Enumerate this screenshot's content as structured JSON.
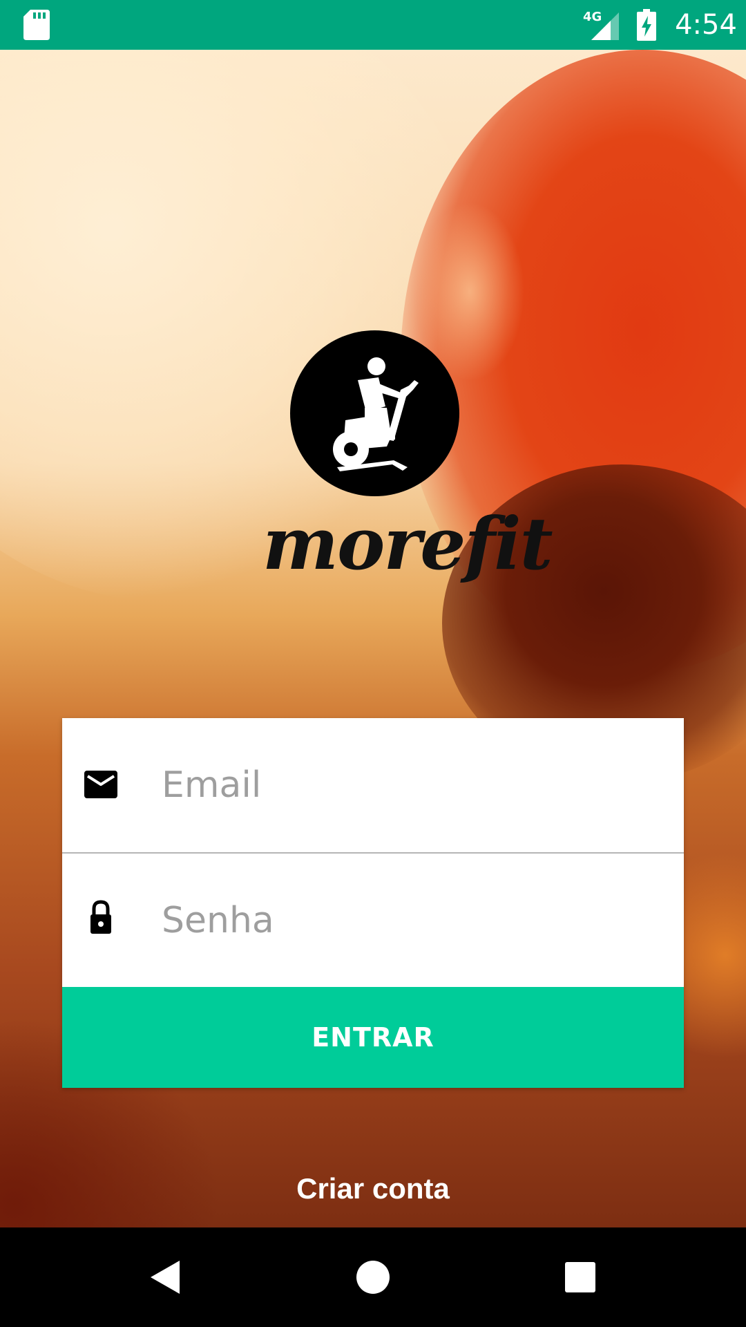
{
  "status_bar": {
    "time": "4:54",
    "network": "4G",
    "icons": [
      "sd-card-icon",
      "signal-icon",
      "battery-charging-icon"
    ]
  },
  "app": {
    "logo_text": "morefit",
    "logo_icon": "exercise-bike-icon"
  },
  "login": {
    "email_placeholder": "Email",
    "email_value": "",
    "password_placeholder": "Senha",
    "password_value": "",
    "submit_label": "ENTRAR",
    "create_account_label": "Criar conta",
    "icons": [
      "email-icon",
      "lock-icon"
    ]
  },
  "colors": {
    "status_bar": "#00a67e",
    "primary_button": "#00cc99",
    "placeholder": "#9e9e9e"
  },
  "nav_bar": {
    "buttons": [
      "back-icon",
      "home-icon",
      "recents-icon"
    ]
  }
}
